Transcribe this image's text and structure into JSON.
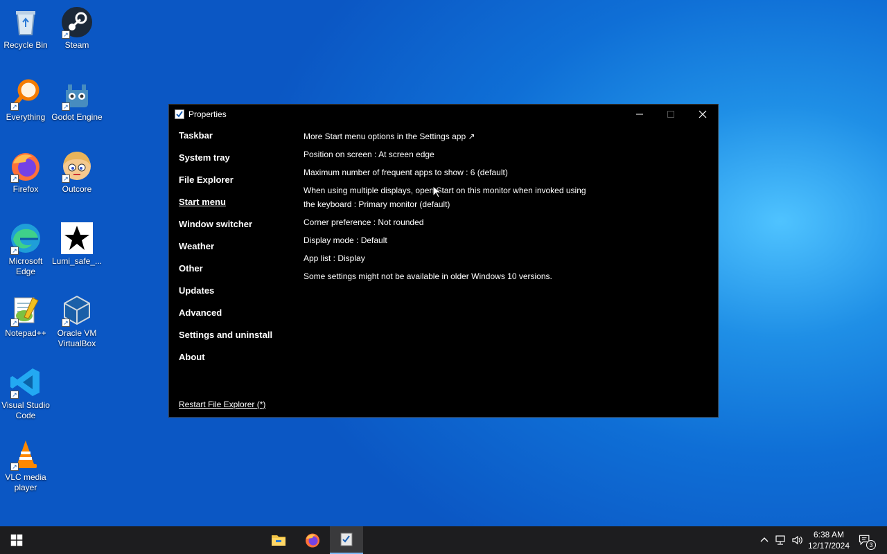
{
  "desktop": {
    "icons": [
      {
        "label": "Recycle Bin",
        "icon": "recycle-bin-icon"
      },
      {
        "label": "Steam",
        "icon": "steam-icon"
      },
      {
        "label": "Everything",
        "icon": "everything-search-icon"
      },
      {
        "label": "Godot Engine",
        "icon": "godot-icon"
      },
      {
        "label": "Firefox",
        "icon": "firefox-icon"
      },
      {
        "label": "Outcore",
        "icon": "outcore-icon"
      },
      {
        "label": "Microsoft Edge",
        "icon": "edge-icon"
      },
      {
        "label": "Lumi_safe_...",
        "icon": "star-icon"
      },
      {
        "label": "Notepad++",
        "icon": "notepadpp-icon"
      },
      {
        "label": "Oracle VM VirtualBox",
        "icon": "virtualbox-icon"
      },
      {
        "label": "Visual Studio Code",
        "icon": "vscode-icon"
      },
      {
        "label": "VLC media player",
        "icon": "vlc-icon"
      }
    ]
  },
  "window": {
    "title": "Properties",
    "nav": [
      {
        "label": "Taskbar",
        "active": false
      },
      {
        "label": "System tray",
        "active": false
      },
      {
        "label": "File Explorer",
        "active": false
      },
      {
        "label": "Start menu",
        "active": true
      },
      {
        "label": "Window switcher",
        "active": false
      },
      {
        "label": "Weather",
        "active": false
      },
      {
        "label": "Other",
        "active": false
      },
      {
        "label": "Updates",
        "active": false
      },
      {
        "label": "Advanced",
        "active": false
      },
      {
        "label": "Settings and uninstall",
        "active": false
      },
      {
        "label": "About",
        "active": false
      }
    ],
    "restart_link": "Restart File Explorer (*)",
    "options": [
      "More Start menu options in the Settings app ↗",
      "Position on screen : At screen edge",
      "Maximum number of frequent apps to show : 6 (default)",
      "When using multiple displays, open Start on this monitor when invoked using the keyboard : Primary monitor (default)",
      "Corner preference : Not rounded",
      "Display mode : Default",
      "App list : Display",
      "Some settings might not be available in older Windows 10 versions."
    ]
  },
  "taskbar": {
    "time": "6:38 AM",
    "date": "12/17/2024",
    "notification_count": "3"
  },
  "colors": {
    "window_bg": "#000000",
    "taskbar_bg": "#1d1d1f",
    "accent": "#7ab8f5"
  }
}
